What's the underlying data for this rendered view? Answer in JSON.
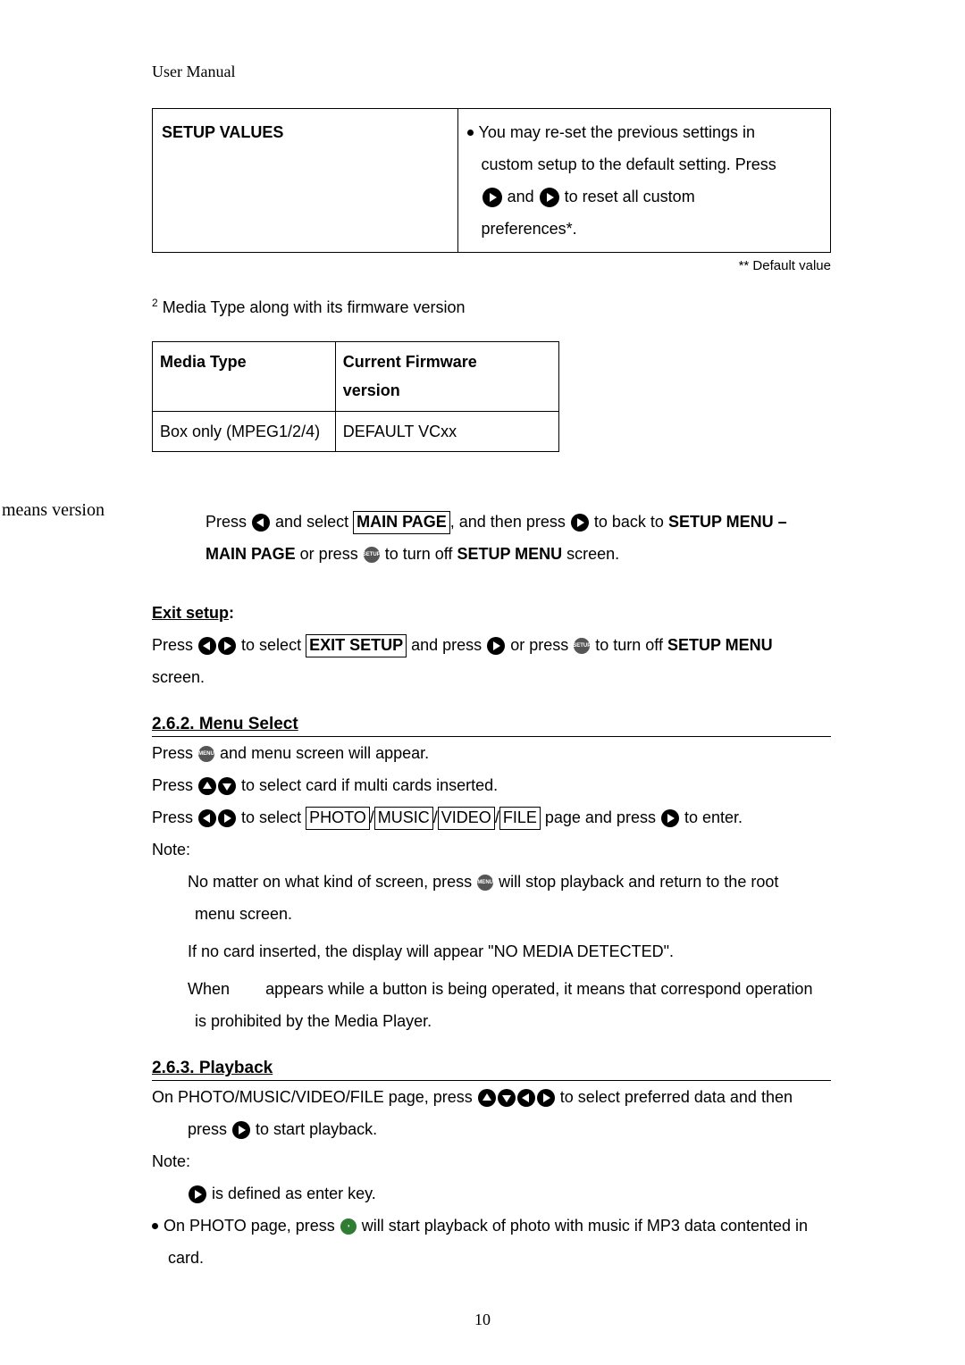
{
  "header": "User Manual",
  "setup_table": {
    "left_header": "SETUP VALUES",
    "right_lines": {
      "l1": "You may re-set the previous settings in",
      "l2": "custom setup to the default setting. Press",
      "l3a": " and ",
      "l3b": " to reset all custom",
      "l4": "preferences*."
    }
  },
  "default_note": "** Default value",
  "footnote2": " Media Type along with its firmware version",
  "media_table": {
    "h1": "Media Type",
    "h2a": "Current Firmware",
    "h2b": "version",
    "r1c1": "Box only (MPEG1/2/4)",
    "r1c2": "DEFAULT VCxx"
  },
  "means_version": "means version",
  "main_page_block": {
    "p1a": "Press ",
    "p1b": " and select ",
    "p1c": "MAIN PAGE",
    "p1d": ", and then press ",
    "p1e": " to back to ",
    "p1f": "SETUP MENU –",
    "p2a": "MAIN PAGE",
    "p2b": " or press ",
    "p2c": " to turn off ",
    "p2d": "SETUP MENU",
    "p2e": " screen."
  },
  "exit_setup": {
    "title": "Exit setup",
    "colon": ":",
    "l1a": "Press ",
    "l1b": " to select ",
    "l1c": "EXIT SETUP",
    "l1d": " and press ",
    "l1e": " or press ",
    "l1f": " to turn off ",
    "l1g": "SETUP MENU",
    "l2": "screen."
  },
  "menu_select": {
    "head": "2.6.2. Menu Select",
    "l1a": "Press ",
    "l1b": " and menu screen will appear.",
    "l2a": "Press ",
    "l2b": " to select card if multi cards inserted.",
    "l3a": "Press ",
    "l3b": " to select ",
    "l3_tabs": {
      "t1": "PHOTO",
      "t2": "MUSIC",
      "t3": "VIDEO",
      "t4": "FILE"
    },
    "l3c": " page and press ",
    "l3d": " to enter.",
    "note_label": "Note:",
    "n1a": "No matter on what kind of screen, press ",
    "n1b": " will stop playback and return to the root",
    "n1c": "menu screen.",
    "n2": "If no card inserted, the display will appear \"NO MEDIA DETECTED\".",
    "n3a": "When",
    "n3b": "appears while a button is being operated, it means that correspond operation",
    "n3c": "is prohibited by the Media Player."
  },
  "playback": {
    "head": "2.6.3. Playback",
    "l1a": "On PHOTO/MUSIC/VIDEO/FILE page, press ",
    "l1b": " to select preferred data and then",
    "l2a": "press ",
    "l2b": " to start playback.",
    "note_label": "Note:",
    "n1a": " is defined as enter key.",
    "n2a": "On PHOTO page, press ",
    "n2b": " will start playback of photo with music if MP3 data contented in",
    "n2c": "card."
  },
  "page_num": "10"
}
